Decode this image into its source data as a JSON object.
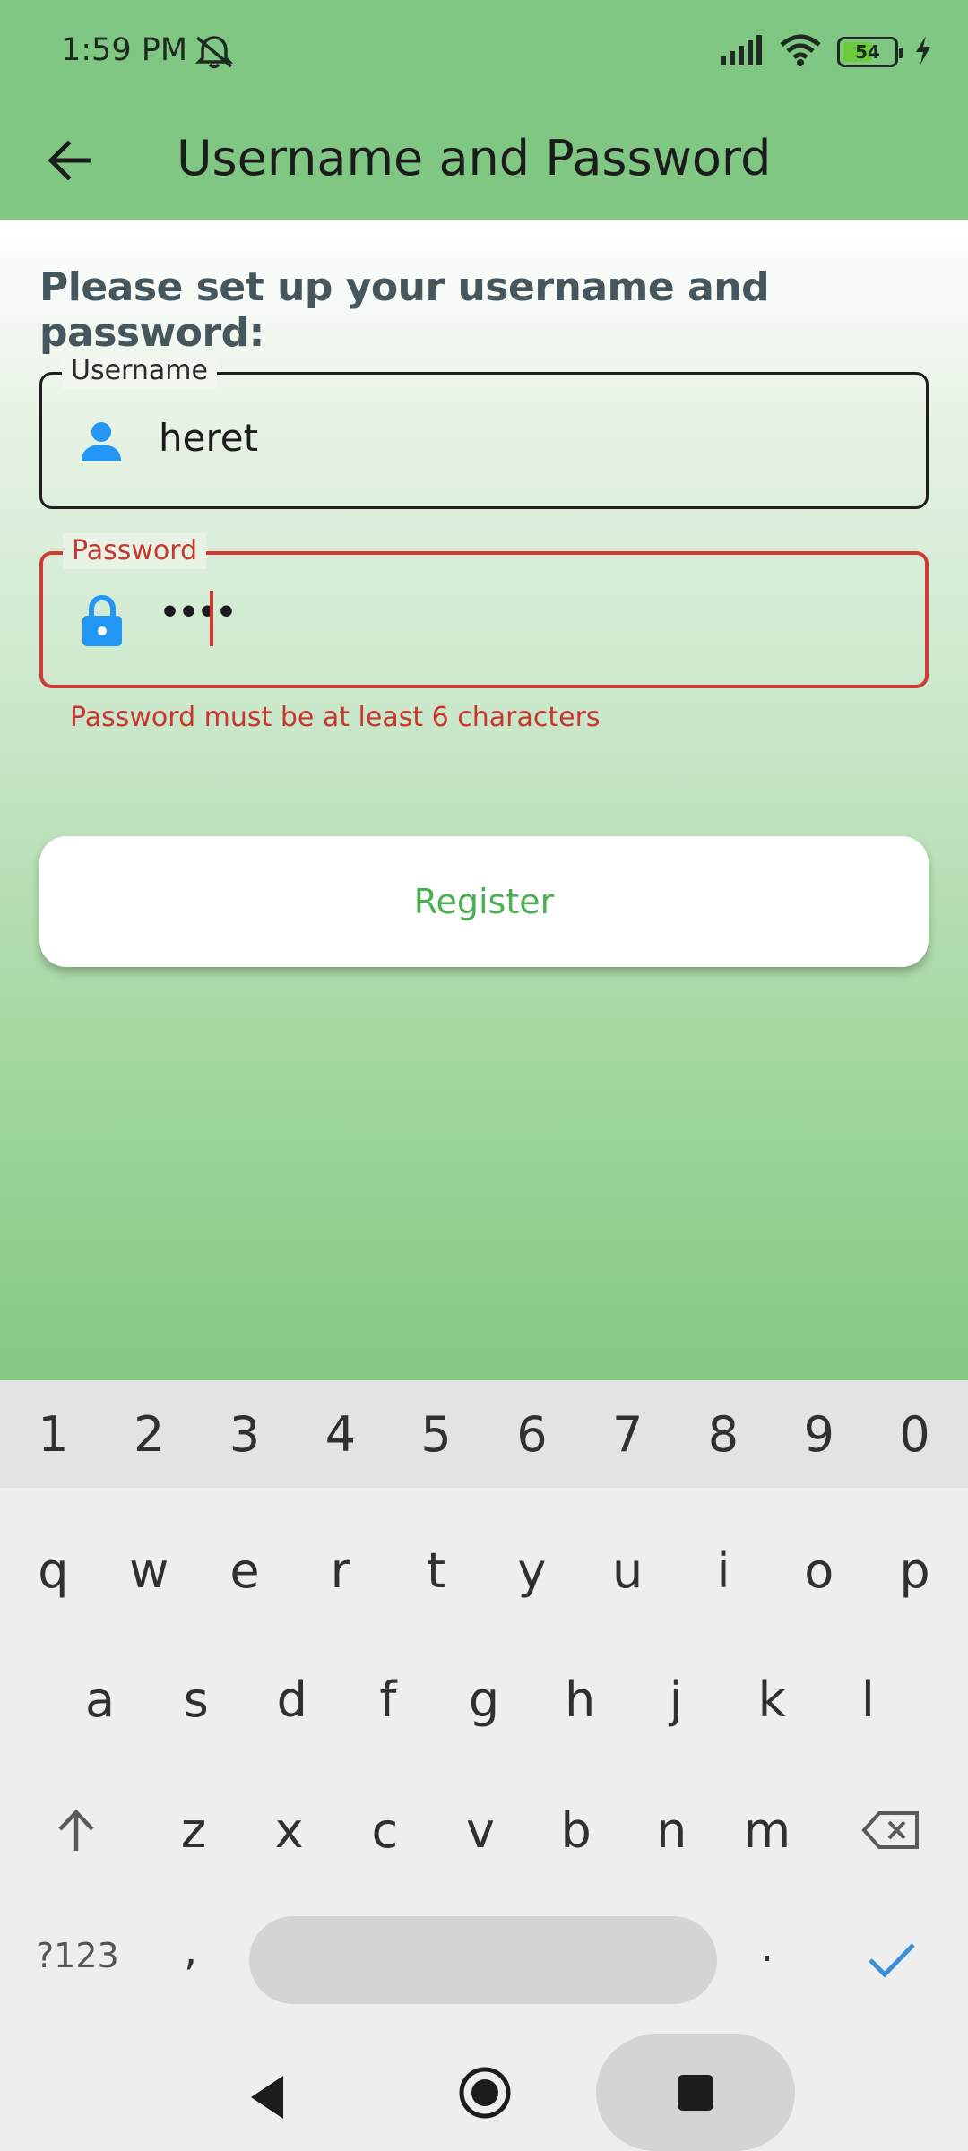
{
  "status_bar": {
    "time": "1:59 PM",
    "battery_level": "54"
  },
  "app_bar": {
    "title": "Username and Password"
  },
  "form": {
    "prompt": "Please set up your username and password:",
    "username": {
      "label": "Username",
      "value": "heret"
    },
    "password": {
      "label": "Password",
      "masked_value": "••••",
      "error": "Password must be at least 6 characters"
    },
    "register_label": "Register"
  },
  "keyboard": {
    "numbers": [
      "1",
      "2",
      "3",
      "4",
      "5",
      "6",
      "7",
      "8",
      "9",
      "0"
    ],
    "row1": [
      "q",
      "w",
      "e",
      "r",
      "t",
      "y",
      "u",
      "i",
      "o",
      "p"
    ],
    "row2": [
      "a",
      "s",
      "d",
      "f",
      "g",
      "h",
      "j",
      "k",
      "l"
    ],
    "row3": [
      "z",
      "x",
      "c",
      "v",
      "b",
      "n",
      "m"
    ],
    "symbols_label": "?123",
    "comma": ",",
    "period": "."
  },
  "colors": {
    "app_bar": "#81c784",
    "error": "#d03a34",
    "accent_icon": "#2196f3",
    "register_text": "#4caf50"
  }
}
